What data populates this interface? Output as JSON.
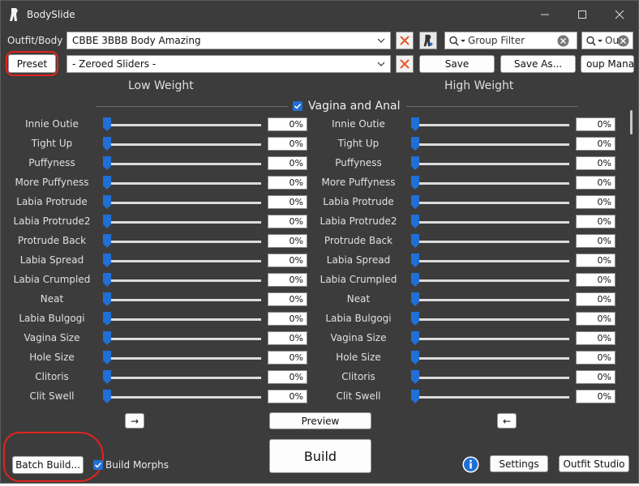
{
  "window": {
    "title": "BodySlide"
  },
  "outfit": {
    "label": "Outfit/Body",
    "value": "CBBE 3BBB Body Amazing"
  },
  "group_filter": {
    "placeholder": "Group Filter"
  },
  "outfit_filter": {
    "placeholder": "Ou"
  },
  "preset": {
    "label": "Preset",
    "value": "- Zeroed Sliders -"
  },
  "buttons": {
    "save": "Save",
    "save_as": "Save As...",
    "group_manager": "oup Manag",
    "preview": "Preview",
    "build": "Build",
    "batch_build": "Batch Build...",
    "settings": "Settings",
    "outfit_studio": "Outfit Studio",
    "arrow_right": "→",
    "arrow_left": "←"
  },
  "headers": {
    "low": "Low Weight",
    "high": "High Weight"
  },
  "group": {
    "name": "Vagina and Anal",
    "checked": true
  },
  "sliders": [
    {
      "name": "Innie Outie",
      "low": "0%",
      "high": "0%"
    },
    {
      "name": "Tight Up",
      "low": "0%",
      "high": "0%"
    },
    {
      "name": "Puffyness",
      "low": "0%",
      "high": "0%"
    },
    {
      "name": "More Puffyness",
      "low": "0%",
      "high": "0%"
    },
    {
      "name": "Labia Protrude",
      "low": "0%",
      "high": "0%"
    },
    {
      "name": "Labia Protrude2",
      "low": "0%",
      "high": "0%"
    },
    {
      "name": "Protrude Back",
      "low": "0%",
      "high": "0%"
    },
    {
      "name": "Labia Spread",
      "low": "0%",
      "high": "0%"
    },
    {
      "name": "Labia Crumpled",
      "low": "0%",
      "high": "0%"
    },
    {
      "name": "Neat",
      "low": "0%",
      "high": "0%"
    },
    {
      "name": "Labia Bulgogi",
      "low": "0%",
      "high": "0%"
    },
    {
      "name": "Vagina Size",
      "low": "0%",
      "high": "0%"
    },
    {
      "name": "Hole Size",
      "low": "0%",
      "high": "0%"
    },
    {
      "name": "Clitoris",
      "low": "0%",
      "high": "0%"
    },
    {
      "name": "Clit Swell",
      "low": "0%",
      "high": "0%"
    }
  ],
  "build_morphs": {
    "label": "Build Morphs",
    "checked": true
  },
  "colors": {
    "background": "#3c3c3c",
    "accent": "#1f6fd6",
    "highlight": "#e0241f",
    "clear": "#e05a2b"
  },
  "icons": {
    "app": "bodyslide-icon",
    "clear": "x-icon",
    "search": "magnifier-icon",
    "info": "info-icon"
  }
}
